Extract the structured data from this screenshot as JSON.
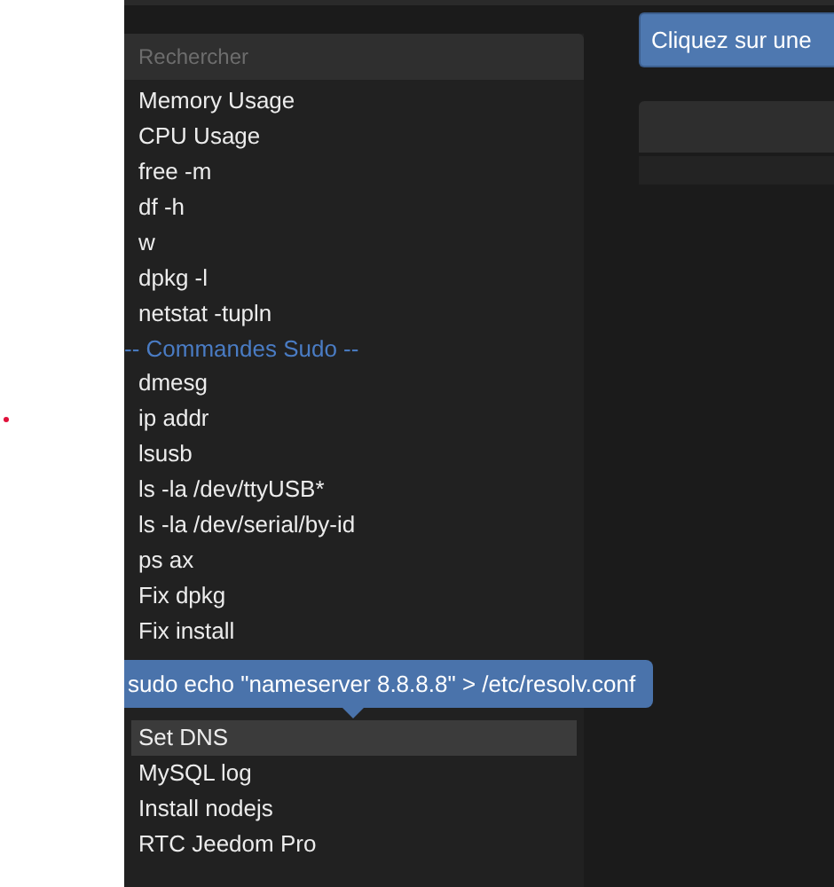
{
  "search": {
    "placeholder": "Rechercher"
  },
  "commands": [
    {
      "kind": "item",
      "label": "Memory Usage",
      "selected": false
    },
    {
      "kind": "item",
      "label": "CPU Usage",
      "selected": false
    },
    {
      "kind": "item",
      "label": "free -m",
      "selected": false
    },
    {
      "kind": "item",
      "label": "df -h",
      "selected": false
    },
    {
      "kind": "item",
      "label": "w",
      "selected": false
    },
    {
      "kind": "item",
      "label": "dpkg -l",
      "selected": false
    },
    {
      "kind": "item",
      "label": "netstat -tupln",
      "selected": false
    },
    {
      "kind": "group",
      "label": "-- Commandes Sudo --"
    },
    {
      "kind": "item",
      "label": "dmesg",
      "selected": false
    },
    {
      "kind": "item",
      "label": "ip addr",
      "selected": false
    },
    {
      "kind": "item",
      "label": "lsusb",
      "selected": false
    },
    {
      "kind": "item",
      "label": "ls -la /dev/ttyUSB*",
      "selected": false
    },
    {
      "kind": "item",
      "label": "ls -la /dev/serial/by-id",
      "selected": false
    },
    {
      "kind": "item",
      "label": "ps ax",
      "selected": false
    },
    {
      "kind": "item",
      "label": "Fix dpkg",
      "selected": false
    },
    {
      "kind": "item",
      "label": "Fix install",
      "selected": false
    },
    {
      "kind": "hidden"
    },
    {
      "kind": "hidden"
    },
    {
      "kind": "item",
      "label": "Set DNS",
      "selected": true
    },
    {
      "kind": "item",
      "label": "MySQL log",
      "selected": false
    },
    {
      "kind": "item",
      "label": "Install nodejs",
      "selected": false
    },
    {
      "kind": "item",
      "label": "RTC Jeedom Pro",
      "selected": false
    }
  ],
  "tooltip": {
    "text": "sudo echo \"nameserver 8.8.8.8\" > /etc/resolv.conf"
  },
  "hint_button": {
    "label": "Cliquez sur une"
  }
}
